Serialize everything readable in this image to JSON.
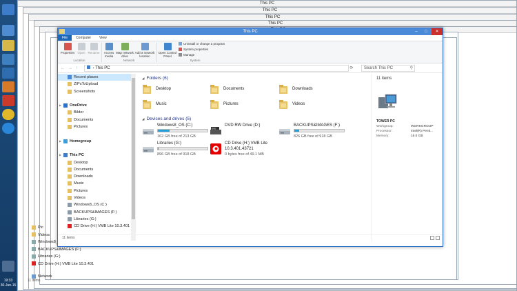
{
  "window": {
    "title": "This PC",
    "menu_tabs": [
      "File",
      "Computer",
      "View"
    ],
    "ribbon": {
      "location_items": [
        "Properties",
        "Open",
        "Rename"
      ],
      "network_items": [
        "Access media",
        "Map network drive",
        "Add a network location"
      ],
      "system_items_big": [
        "Open Control Panel"
      ],
      "system_items_small": [
        "Uninstall or change a program",
        "System properties",
        "Manage"
      ],
      "groups": [
        "Location",
        "Network",
        "System"
      ]
    },
    "address": "This PC",
    "search_placeholder": "Search This PC",
    "status": "11 items"
  },
  "nav_pane": [
    {
      "label": "Recent places",
      "level": 1,
      "selected": true,
      "icon": "recent-places-icon"
    },
    {
      "label": "ZIPsToUpload",
      "level": 1,
      "icon": "folder-icon"
    },
    {
      "label": "Screenshots",
      "level": 1,
      "icon": "folder-icon"
    },
    {
      "label": "",
      "level": 0,
      "spacer": true
    },
    {
      "label": "OneDrive",
      "level": 0,
      "bold": true,
      "icon": "onedrive-icon"
    },
    {
      "label": "Bilder",
      "level": 1,
      "icon": "folder-icon"
    },
    {
      "label": "Documents",
      "level": 1,
      "icon": "folder-icon"
    },
    {
      "label": "Pictures",
      "level": 1,
      "icon": "folder-icon"
    },
    {
      "label": "",
      "level": 0,
      "spacer": true
    },
    {
      "label": "Homegroup",
      "level": 0,
      "bold": true,
      "icon": "homegroup-icon"
    },
    {
      "label": "",
      "level": 0,
      "spacer": true
    },
    {
      "label": "This PC",
      "level": 0,
      "bold": true,
      "icon": "pc-icon"
    },
    {
      "label": "Desktop",
      "level": 1,
      "icon": "folder-icon"
    },
    {
      "label": "Documents",
      "level": 1,
      "icon": "folder-icon"
    },
    {
      "label": "Downloads",
      "level": 1,
      "icon": "folder-icon"
    },
    {
      "label": "Music",
      "level": 1,
      "icon": "folder-icon"
    },
    {
      "label": "Pictures",
      "level": 1,
      "icon": "folder-icon"
    },
    {
      "label": "Videos",
      "level": 1,
      "icon": "folder-icon"
    },
    {
      "label": "Windows8_OS (C:)",
      "level": 1,
      "icon": "drive-icon"
    },
    {
      "label": "BACKUPS&IMAGES (F:)",
      "level": 1,
      "icon": "drive-icon"
    },
    {
      "label": "Libraries (G:)",
      "level": 1,
      "icon": "drive-icon"
    },
    {
      "label": "CD Drive (H:) VMB Lite 10.3.401",
      "level": 1,
      "icon": "cd-drive-icon"
    }
  ],
  "folders_header": "Folders (6)",
  "folders": [
    "Desktop",
    "Documents",
    "Downloads",
    "Music",
    "Pictures",
    "Videos"
  ],
  "drives_header": "Devices and drives (5)",
  "drives": [
    {
      "name": "Windows8_OS (C:)",
      "free": "162 GB free of 213 GB",
      "used_fraction": 0.24,
      "icon": "hard-drive-icon"
    },
    {
      "name": "DVD RW Drive (D:)",
      "free": "",
      "icon": "dvd-drive-icon"
    },
    {
      "name": "BACKUPS&IMAGES (F:)",
      "free": "826 GB free of 918 GB",
      "used_fraction": 0.1,
      "icon": "hard-drive-icon"
    },
    {
      "name": "Libraries (G:)",
      "free": "896 GB free of 918 GB",
      "used_fraction": 0.02,
      "icon": "hard-drive-icon"
    },
    {
      "name": "CD Drive (H:) VMB Lite",
      "name2": "10.3.401.43721",
      "free": "0 bytes free of 49.1 MB",
      "icon": "vodafone-drive-icon"
    }
  ],
  "details": {
    "count": "11 items",
    "name": "TOWER PC",
    "rows": [
      {
        "label": "Workgroup:",
        "value": "WORKGROUP"
      },
      {
        "label": "Processor:",
        "value": "Intel(R) Penti..."
      },
      {
        "label": "Memory:",
        "value": "16.0 GB"
      }
    ]
  },
  "background": {
    "window_title": "This PC",
    "under_nav": [
      "Pic",
      "Videos",
      "Windows8_OS",
      "BACKUPS&IMAGES (F:)",
      "Libraries (G:)",
      "CD Drive (H:) VMB Lite 10.3.401"
    ],
    "network_label": "Network",
    "status": "11 items"
  },
  "clock": {
    "time": "19:33",
    "date": "30-Jun-15"
  },
  "colors": {
    "accent": "#1e67b8",
    "titlebar": "#4a8ad8",
    "selection": "#cce8ff",
    "drivebar": "#26a0da"
  }
}
